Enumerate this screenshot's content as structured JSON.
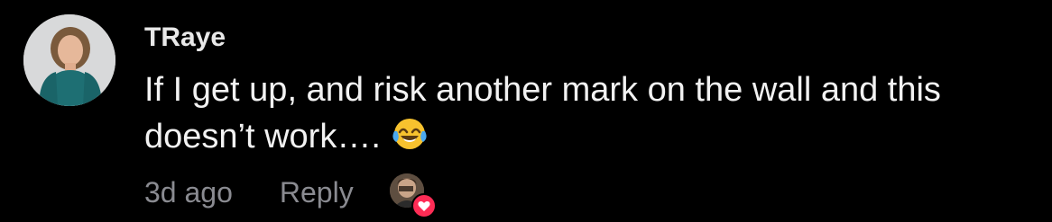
{
  "comment": {
    "username": "TRaye",
    "text": "If I get up, and risk another mark on the wall and this doesn’t work….",
    "emoji": "😂",
    "time": "3d ago",
    "reply_label": "Reply"
  },
  "icons": {
    "avatar": "user-avatar",
    "emoji": "face-with-tears-of-joy-icon",
    "liker_avatar": "creator-liked-avatar",
    "heart_badge": "heart-icon"
  },
  "colors": {
    "background": "#000000",
    "text": "#f2f2f2",
    "meta": "#8a8b91",
    "heart": "#fe2c55"
  }
}
